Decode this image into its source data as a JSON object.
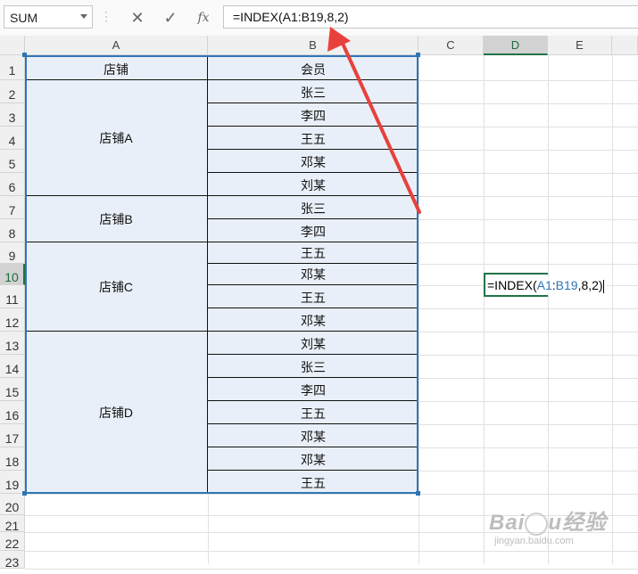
{
  "name_box": {
    "value": "SUM"
  },
  "formula_bar": {
    "cancel_glyph": "✕",
    "enter_glyph": "✓",
    "fx_glyph": "fx",
    "formula": "=INDEX(A1:B19,8,2)"
  },
  "columns": [
    "A",
    "B",
    "C",
    "D",
    "E"
  ],
  "rows": [
    "1",
    "2",
    "3",
    "4",
    "5",
    "6",
    "7",
    "8",
    "9",
    "10",
    "11",
    "12",
    "13",
    "14",
    "15",
    "16",
    "17",
    "18",
    "19",
    "20",
    "21",
    "22",
    "23"
  ],
  "active_row": "10",
  "active_column": "D",
  "table": {
    "header_a": "店铺",
    "header_b": "会员",
    "groups": [
      {
        "store": "店铺A",
        "members": [
          "张三",
          "李四",
          "王五",
          "邓某",
          "刘某"
        ]
      },
      {
        "store": "店铺B",
        "members": [
          "张三",
          "李四"
        ]
      },
      {
        "store": "店铺C",
        "members": [
          "王五",
          "邓某",
          "王五",
          "邓某"
        ]
      },
      {
        "store": "店铺D",
        "members": [
          "刘某",
          "张三",
          "李四",
          "王五",
          "邓某",
          "邓某",
          "王五"
        ]
      }
    ]
  },
  "editing_cell": {
    "prefix": "=INDEX(",
    "ref_a": "A1",
    "colon": ":",
    "ref_b": "B19",
    "suffix": ",8,2)"
  },
  "colors": {
    "table_fill": "#e9eff8",
    "selection": "#217346",
    "reference": "#2e75b6",
    "arrow": "#e8413c"
  },
  "watermark": "Baidu经验 jingyan.baidu.com"
}
